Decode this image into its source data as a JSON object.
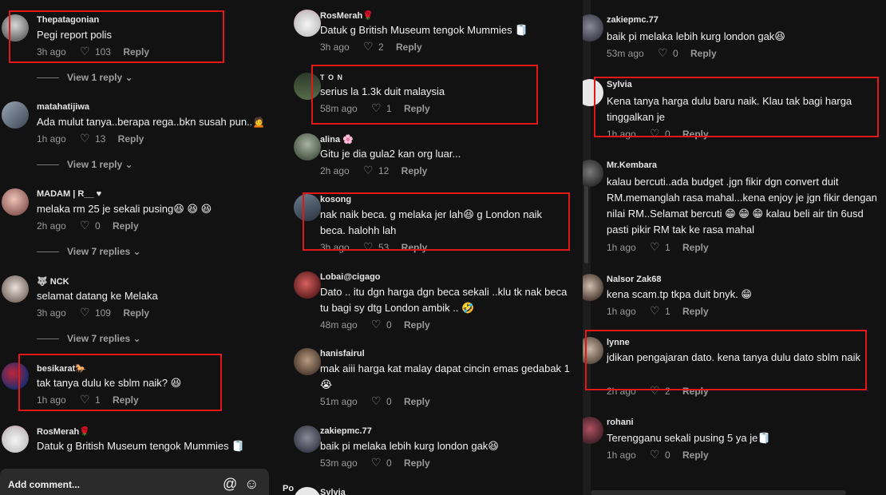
{
  "labels": {
    "reply": "Reply",
    "heart": "♡"
  },
  "composer": {
    "placeholder": "Add comment...",
    "at": "@",
    "emoji": "☺"
  },
  "col1": {
    "comments": [
      {
        "user": "Thepatagonian",
        "text": "Pegi report polis",
        "time": "3h ago",
        "likes": "103"
      },
      {
        "user": "matahatijiwa",
        "text": "Ada mulut tanya..berapa rega..bkn susah pun..🙍",
        "time": "1h ago",
        "likes": "13"
      },
      {
        "user": "MADAM | R__ ♥",
        "text": "melaka rm 25 je sekali pusing😆 😆 😆",
        "time": "2h ago",
        "likes": "0"
      },
      {
        "user": "🐺 NCK",
        "text": "selamat datang ke Melaka",
        "time": "3h ago",
        "likes": "109"
      },
      {
        "user": "besikarat🐎",
        "text": "tak tanya dulu ke sblm naik? 😆",
        "time": "1h ago",
        "likes": "1"
      },
      {
        "user": "RosMerah🌹",
        "text": "Datuk g British Museum tengok Mummies 🧻",
        "time": "",
        "likes": ""
      }
    ],
    "view_replies": [
      "View 1 reply ⌄",
      "View 1 reply ⌄",
      "View 7 replies ⌄",
      "View 7 replies ⌄"
    ]
  },
  "col2": {
    "comments": [
      {
        "user": "RosMerah🌹",
        "text": "Datuk g British Museum tengok Mummies 🧻",
        "time": "3h ago",
        "likes": "2"
      },
      {
        "user": "T O N",
        "text": "serius la 1.3k duit malaysia",
        "time": "58m ago",
        "likes": "1"
      },
      {
        "user": "alina 🌸",
        "text": "Gitu je dia gula2 kan org luar...",
        "time": "2h ago",
        "likes": "12"
      },
      {
        "user": "kosong",
        "text": "nak naik beca. g melaka jer lah😆 g London naik beca. halohh lah",
        "time": "3h ago",
        "likes": "53"
      },
      {
        "user": "Lobai@cigago",
        "text": "Dato .. itu dgn harga dgn beca sekali ..klu tk nak beca tu bagi sy dtg London ambik .. 🤣",
        "time": "48m ago",
        "likes": "0"
      },
      {
        "user": "hanisfairul",
        "text": "mak aiii harga kat malay dapat cincin emas gedabak 1😭",
        "time": "51m ago",
        "likes": "0"
      },
      {
        "user": "zakiepmc.77",
        "text": "baik pi melaka lebih kurg london gak😆",
        "time": "53m ago",
        "likes": "0"
      },
      {
        "user": "Sylvia",
        "text": "",
        "time": "",
        "likes": ""
      }
    ],
    "edge_text": "Po"
  },
  "col3": {
    "comments": [
      {
        "user": "zakiepmc.77",
        "text": "baik pi melaka lebih kurg london gak😆",
        "time": "53m ago",
        "likes": "0"
      },
      {
        "user": "Sylvia",
        "text": "Kena tanya harga dulu baru naik. Klau tak bagi harga tinggalkan je",
        "time": "1h ago",
        "likes": "0"
      },
      {
        "user": "Mr.Kembara",
        "text": "kalau bercuti..ada budget .jgn fikir dgn convert duit RM.memanglah rasa mahal...kena enjoy je jgn fikir dengan nilai RM..Selamat bercuti 😁 😁 😁 kalau beli air tin 6usd pasti pikir RM tak ke rasa mahal",
        "time": "1h ago",
        "likes": "1"
      },
      {
        "user": "Nalsor Zak68",
        "text": "kena scam.tp tkpa duit bnyk. 😁",
        "time": "1h ago",
        "likes": "1"
      },
      {
        "user": "lynne",
        "text": "jdikan pengajaran dato. kena tanya dulu dato sblm naik",
        "time": "2h ago",
        "likes": "2"
      },
      {
        "user": "rohani",
        "text": "Terengganu sekali pusing 5 ya je🧻",
        "time": "1h ago",
        "likes": "0"
      }
    ]
  }
}
